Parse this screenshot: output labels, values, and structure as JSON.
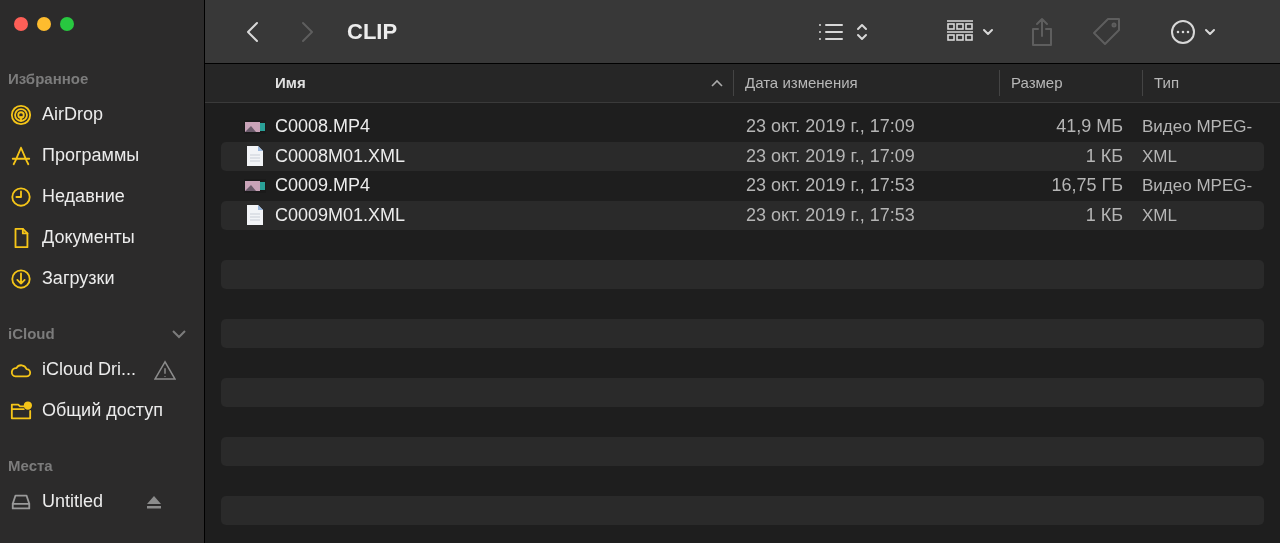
{
  "window": {
    "title": "CLIP"
  },
  "toolbar": [
    {
      "kind": "back",
      "disabled": false
    },
    {
      "kind": "forward",
      "disabled": true
    },
    {
      "kind": "list-view",
      "disabled": false
    },
    {
      "kind": "group",
      "disabled": false
    },
    {
      "kind": "share",
      "disabled": true
    },
    {
      "kind": "tag",
      "disabled": true
    },
    {
      "kind": "more",
      "disabled": false
    }
  ],
  "sidebar": [
    {
      "title": "Избранное",
      "items": [
        {
          "label": "AirDrop",
          "kind": "airdrop"
        },
        {
          "label": "Программы",
          "kind": "apps"
        },
        {
          "label": "Недавние",
          "kind": "clock"
        },
        {
          "label": "Документы",
          "kind": "doc"
        },
        {
          "label": "Загрузки",
          "kind": "download"
        }
      ]
    },
    {
      "title": "iCloud",
      "expanded": true,
      "items": [
        {
          "label": "iCloud Dri...",
          "kind": "cloud"
        },
        {
          "label": "Общий доступ",
          "kind": "shared"
        }
      ]
    },
    {
      "title": "Места",
      "items": [
        {
          "label": "Untitled",
          "kind": "disk"
        }
      ]
    }
  ],
  "table": {
    "columns": [
      {
        "label": "Имя",
        "sorted": true
      },
      {
        "label": "Дата изменения",
        "sorted": false
      },
      {
        "label": "Размер",
        "sorted": false
      },
      {
        "label": "Тип",
        "sorted": false
      }
    ],
    "rows": [
      {
        "kind": "video",
        "name": "C0008.MP4",
        "date": "23 окт. 2019 г., 17:09",
        "size": "41,9 МБ",
        "type": "Видео MPEG-"
      },
      {
        "kind": "xml",
        "name": "C0008M01.XML",
        "date": "23 окт. 2019 г., 17:09",
        "size": "1 КБ",
        "type": "XML"
      },
      {
        "kind": "video",
        "name": "C0009.MP4",
        "date": "23 окт. 2019 г., 17:53",
        "size": "16,75 ГБ",
        "type": "Видео MPEG-"
      },
      {
        "kind": "xml",
        "name": "C0009M01.XML",
        "date": "23 окт. 2019 г., 17:53",
        "size": "1 КБ",
        "type": "XML"
      }
    ]
  }
}
